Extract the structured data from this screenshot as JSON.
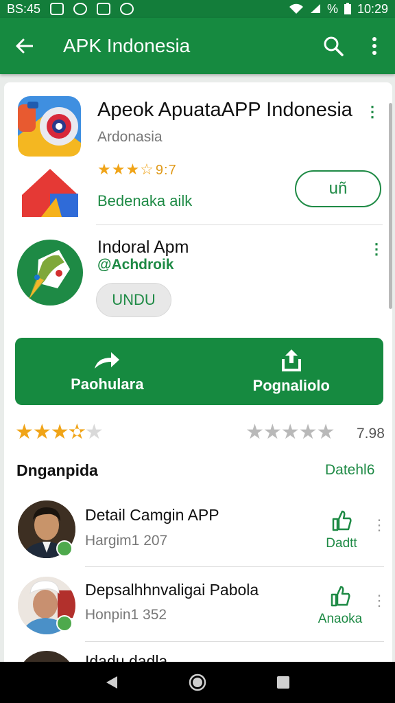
{
  "status_bar": {
    "left_text": "BS:45",
    "time": "10:29",
    "battery_pct": "%"
  },
  "app_bar": {
    "title": "APK Indonesia"
  },
  "featured_app": {
    "title": "Apeok ApuataAPP Indonesia",
    "subtitle": "Ardonasia",
    "rating_text": "★★★☆",
    "rating_number": "9:7",
    "tagline": "Bedenaka ailk",
    "button_label": "uñ"
  },
  "second_app": {
    "title": "Indoral Apm",
    "handle": "@Achdroik",
    "button_label": "UNDU"
  },
  "actions": [
    {
      "label": "Paohulara",
      "icon": "share-arrow-icon"
    },
    {
      "label": "Pognaliolo",
      "icon": "upload-icon"
    }
  ],
  "rating_summary": {
    "user_stars": 3.5,
    "overall_stars": 0,
    "number": "7.98"
  },
  "section": {
    "title": "Dnganpida",
    "link": "Datehl6"
  },
  "reviews": [
    {
      "name": "Detail Camgin APP",
      "meta": "Hargim1 207",
      "action_label": "Dadtt"
    },
    {
      "name": "Depsalhhnvaligai Pabola",
      "meta": "Honpin1 352",
      "action_label": "Anaoka"
    },
    {
      "name": "Idadu.dadla"
    }
  ],
  "colors": {
    "primary": "#168a40",
    "accent_text": "#1e8a45",
    "star": "#f0a418"
  }
}
